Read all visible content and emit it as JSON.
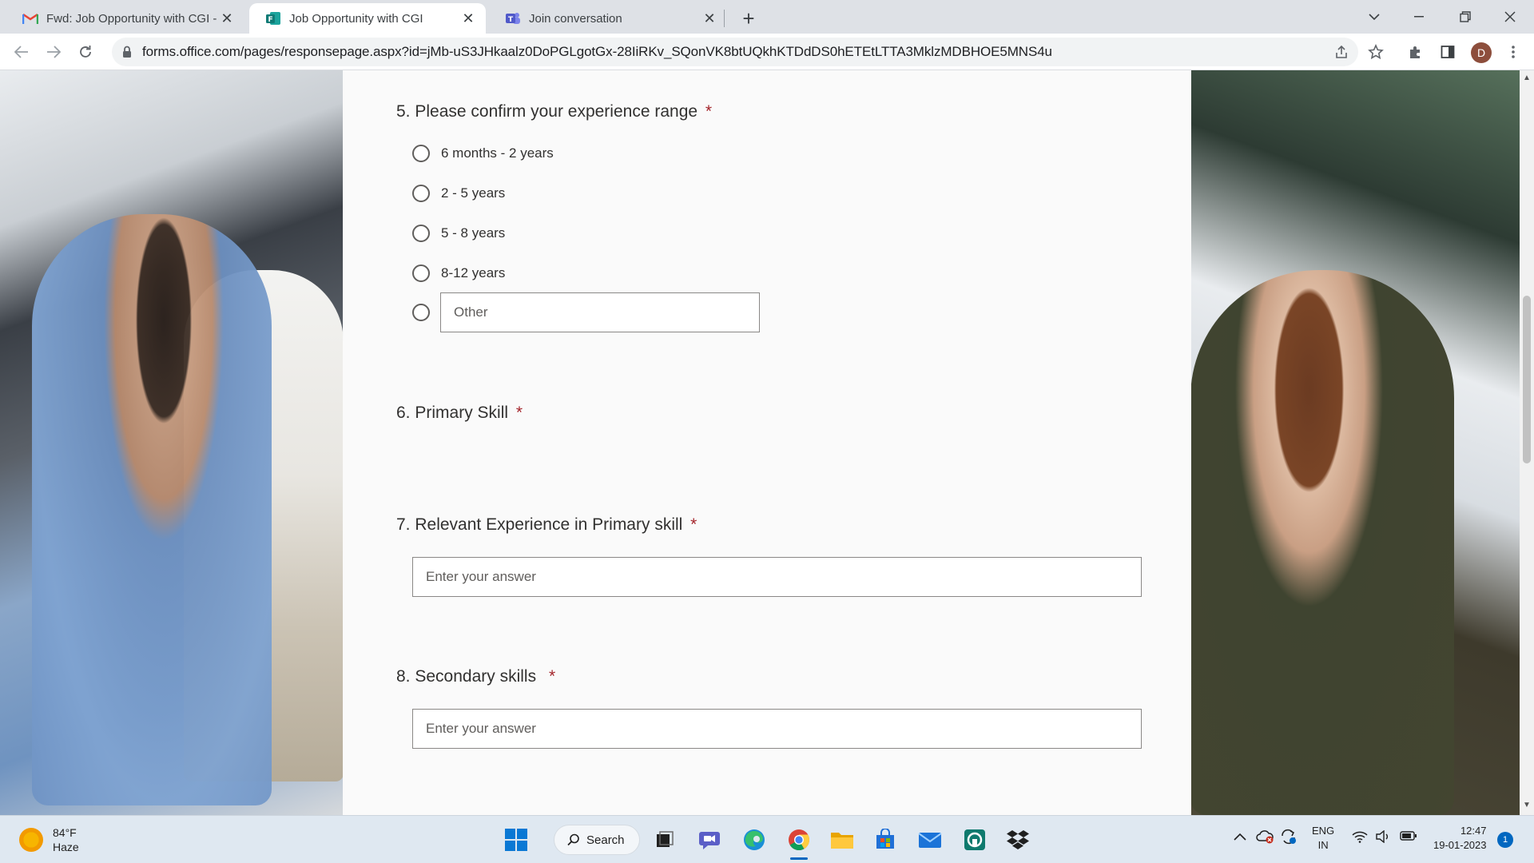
{
  "browser": {
    "tabs": [
      {
        "title": "Fwd: Job Opportunity with CGI - ",
        "favicon": "gmail-icon"
      },
      {
        "title": "Job Opportunity with CGI",
        "favicon": "forms-icon"
      },
      {
        "title": "Join conversation",
        "favicon": "teams-icon"
      }
    ],
    "url": "forms.office.com/pages/responsepage.aspx?id=jMb-uS3JHkaalz0DoPGLgotGx-28IiRKv_SQonVK8btUQkhKTDdDS0hETEtLTTA3MklzMDBHOE5MNS4u",
    "profile_initial": "D"
  },
  "form": {
    "q5": {
      "number": "5.",
      "title": "Please confirm your experience range",
      "required_mark": "*",
      "options": [
        "6 months - 2 years",
        "2 - 5 years",
        "5 - 8 years",
        "8-12 years"
      ],
      "other_placeholder": "Other"
    },
    "q6": {
      "number": "6.",
      "title": "Primary Skill",
      "required_mark": "*"
    },
    "q7": {
      "number": "7.",
      "title": "Relevant Experience in Primary skill",
      "required_mark": "*",
      "placeholder": "Enter your answer"
    },
    "q8": {
      "number": "8.",
      "title": "Secondary skills",
      "required_mark": "*",
      "placeholder": "Enter your answer"
    }
  },
  "taskbar": {
    "weather_temp": "84°F",
    "weather_desc": "Haze",
    "search_label": "Search",
    "lang_primary": "ENG",
    "lang_secondary": "IN",
    "time": "12:47",
    "date": "19-01-2023",
    "notification_count": "1"
  }
}
